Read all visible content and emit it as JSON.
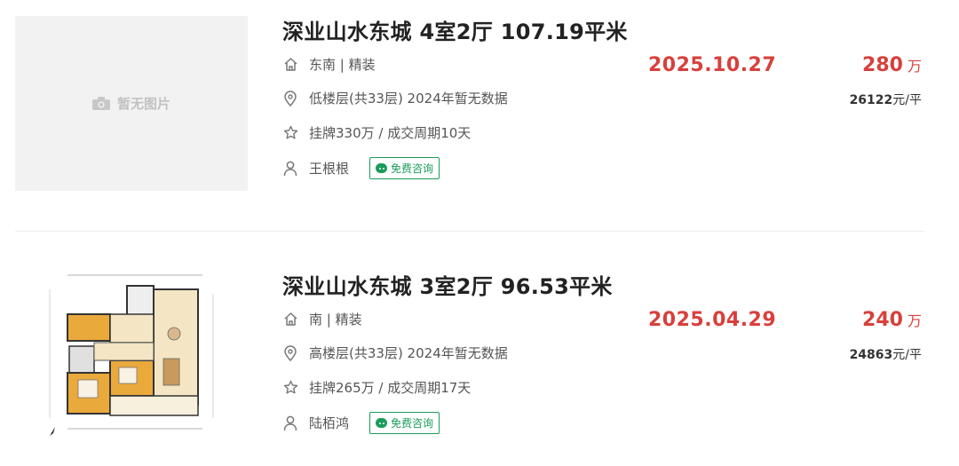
{
  "listings": [
    {
      "no_image_text": "暂无图片",
      "title": "深业山水东城 4室2厅 107.19平米",
      "orientation": "东南 | 精装",
      "floor": "低楼层(共33层) 2024年暂无数据",
      "listing": "挂牌330万 / 成交周期10天",
      "agent": "王根根",
      "chat_label": "免费咨询",
      "deal_date": "2025.10.27",
      "total_price": "280",
      "total_unit": "万",
      "unit_price": "26122",
      "unit_price_suffix": "元/平"
    },
    {
      "title": "深业山水东城 3室2厅 96.53平米",
      "orientation": "南 | 精装",
      "floor": "高楼层(共33层) 2024年暂无数据",
      "listing": "挂牌265万 / 成交周期17天",
      "agent": "陆栢鸿",
      "chat_label": "免费咨询",
      "deal_date": "2025.04.29",
      "total_price": "240",
      "total_unit": "万",
      "unit_price": "24863",
      "unit_price_suffix": "元/平"
    }
  ],
  "colors": {
    "accent_red": "#d8403c",
    "chat_green": "#1a9c5a"
  },
  "icons": [
    "home-icon",
    "location-pin-icon",
    "star-icon",
    "person-icon",
    "wechat-icon",
    "camera-icon"
  ]
}
